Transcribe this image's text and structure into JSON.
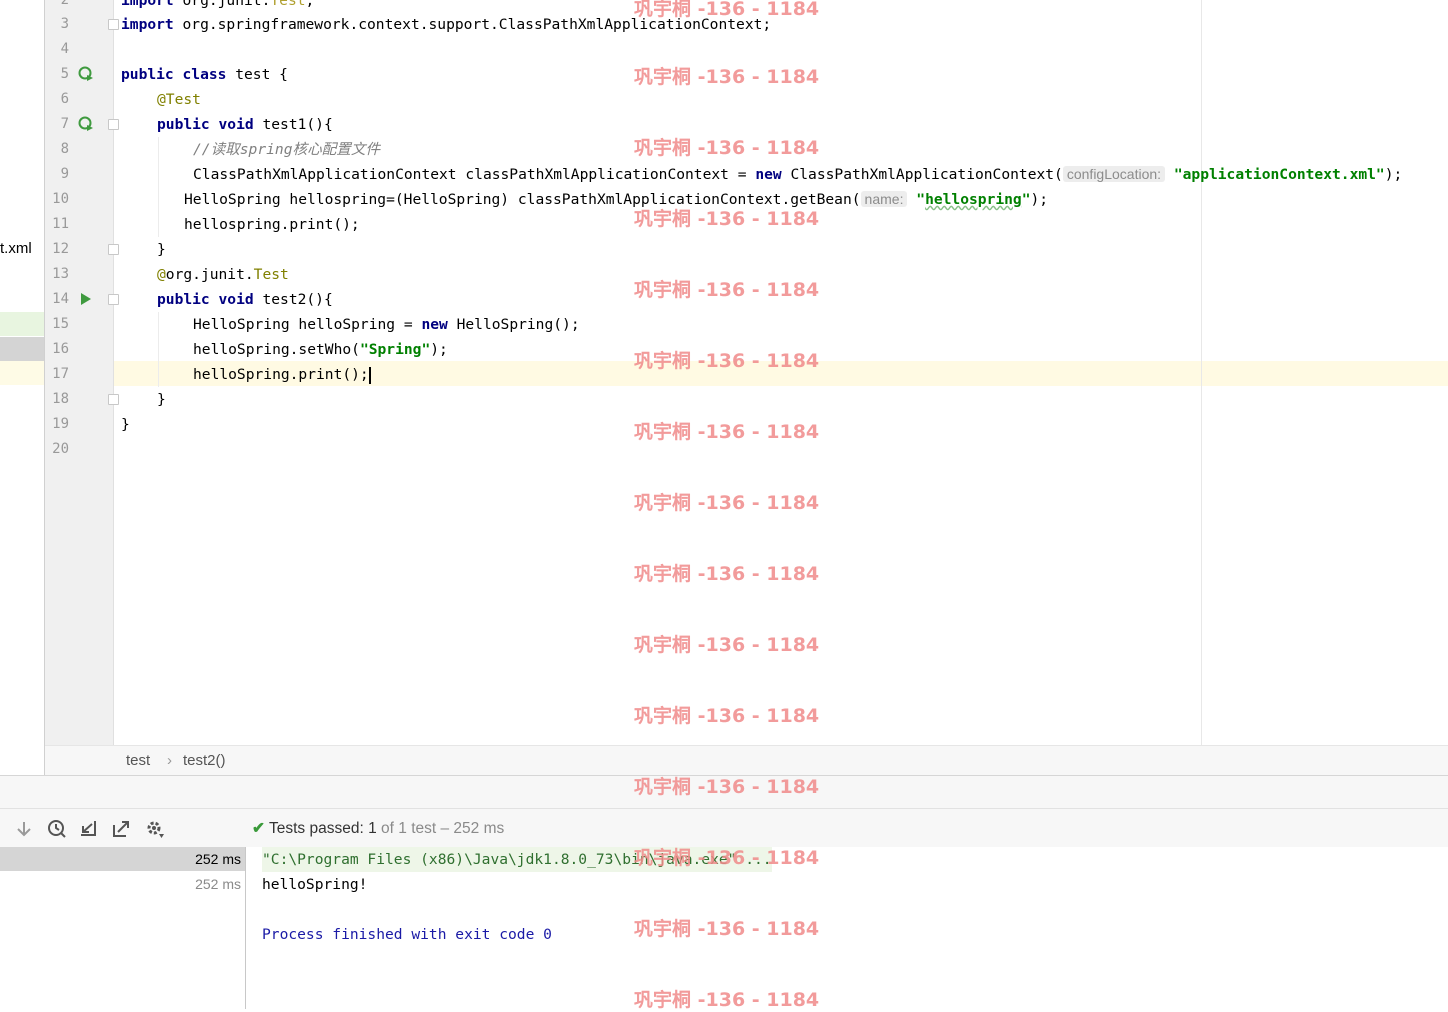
{
  "project_panel": {
    "visible_file": "t.xml"
  },
  "editor": {
    "line_numbers": [
      "2",
      "3",
      "4",
      "5",
      "6",
      "7",
      "8",
      "9",
      "10",
      "11",
      "12",
      "13",
      "14",
      "15",
      "16",
      "17",
      "18",
      "19",
      "20"
    ],
    "code": {
      "l2_kw": "import",
      "l2_rest": " org.junit.",
      "l2_cls": "Test",
      "l2_end": ";",
      "l3_kw": "import",
      "l3_rest": " org.springframework.context.support.ClassPathXmlApplicationContext;",
      "l5_kw1": "public",
      "l5_kw2": "class",
      "l5_rest": " test {",
      "l6_ann": "@Test",
      "l7_kw1": "public",
      "l7_kw2": "void",
      "l7_rest": " test1(){",
      "l8_cmt": "//读取spring核心配置文件",
      "l9_a": "ClassPathXmlApplicationContext classPathXmlApplicationContext = ",
      "l9_kw": "new",
      "l9_b": " ClassPathXmlApplicationContext(",
      "l9_hint": "configLocation:",
      "l9_str": "\"applicationContext.xml\"",
      "l9_end": ");",
      "l10_a": "HelloSpring hellospring=(HelloSpring) classPathXmlApplicationContext.getBean(",
      "l10_hint": "name:",
      "l10_str_q1": "\"",
      "l10_str": "hellospring",
      "l10_str_q2": "\"",
      "l10_end": ");",
      "l11": "hellospring.print();",
      "l12": "}",
      "l13_ann": "@",
      "l13_mid": "org.junit.",
      "l13_cls": "Test",
      "l14_kw1": "public",
      "l14_kw2": "void",
      "l14_rest": " test2(){",
      "l15_a": "HelloSpring helloSpring = ",
      "l15_kw": "new",
      "l15_b": " HelloSpring();",
      "l16_a": "helloSpring.setWho(",
      "l16_str": "\"Spring\"",
      "l16_end": ");",
      "l17": "helloSpring.print();",
      "l18": "}",
      "l19": "}"
    }
  },
  "breadcrumb": {
    "class": "test",
    "sep": "›",
    "method": "test2()"
  },
  "run_panel": {
    "toolbar_icons": [
      "arrow-down-icon",
      "history-icon",
      "import-icon",
      "export-icon",
      "settings-icon"
    ],
    "status_check": "✔",
    "status_label": "Tests passed:",
    "status_count": "1",
    "status_rest": "of 1 test – 252 ms",
    "tree": [
      {
        "time": "252 ms"
      },
      {
        "time": "252 ms"
      }
    ],
    "console": {
      "cmd": "\"C:\\Program Files (x86)\\Java\\jdk1.8.0_73\\bin\\java.exe\" ...",
      "output": "helloSpring!",
      "exit": "Process finished with exit code 0"
    }
  },
  "watermark": "巩宇桐 -136 - 1184",
  "colors": {
    "keyword": "#000080",
    "string": "#008000",
    "annotation": "#808000",
    "comment": "#808080",
    "watermark": "#f08a8a",
    "pass": "#3a9a3a"
  }
}
